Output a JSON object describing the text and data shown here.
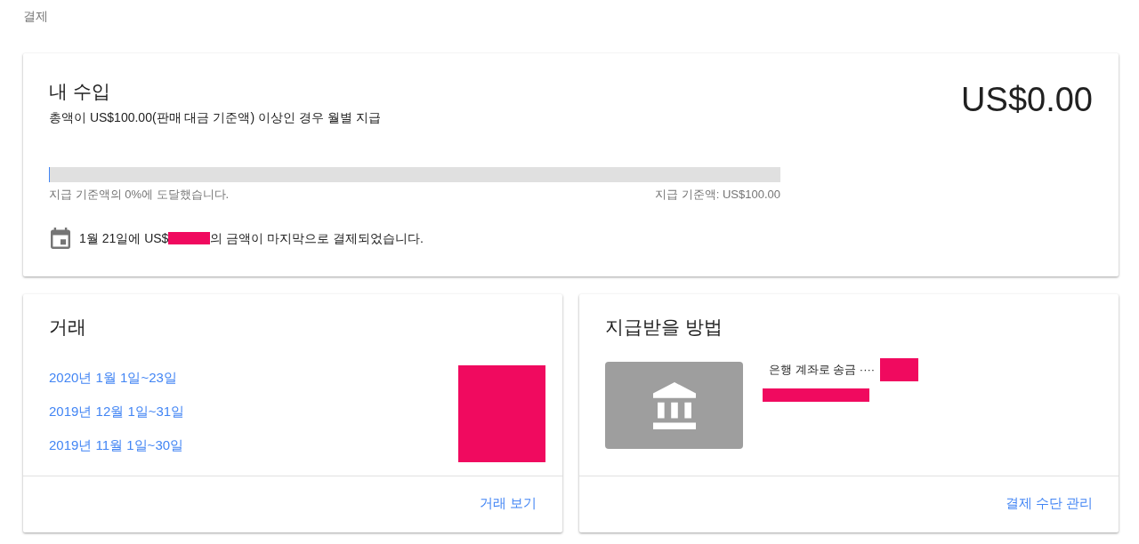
{
  "breadcrumb": "결제",
  "earnings": {
    "title": "내 수입",
    "subtitle": "총액이 US$100.00(판매 대금 기준액) 이상인 경우 월별 지급",
    "balance": "US$0.00",
    "progress": {
      "level": 0,
      "caption": "지급 기준액의 0%에 도달했습니다.",
      "threshold": "지급 기준액: US$100.00"
    },
    "last_payment": {
      "before": "1월 21일에 US$",
      "redacted": true,
      "after": "의 금액이 마지막으로 결제되었습니다."
    }
  },
  "transactions": {
    "title": "거래",
    "periods": [
      "2020년 1월 1일~23일",
      "2019년 12월 1일~31일",
      "2019년 11월 1일~30일"
    ],
    "redacted": true,
    "action": "거래 보기"
  },
  "payment_method": {
    "title": "지급받을 방법",
    "method": "은행 계좌로 송금 ····",
    "redacted": true,
    "action": "결제 수단 관리"
  }
}
